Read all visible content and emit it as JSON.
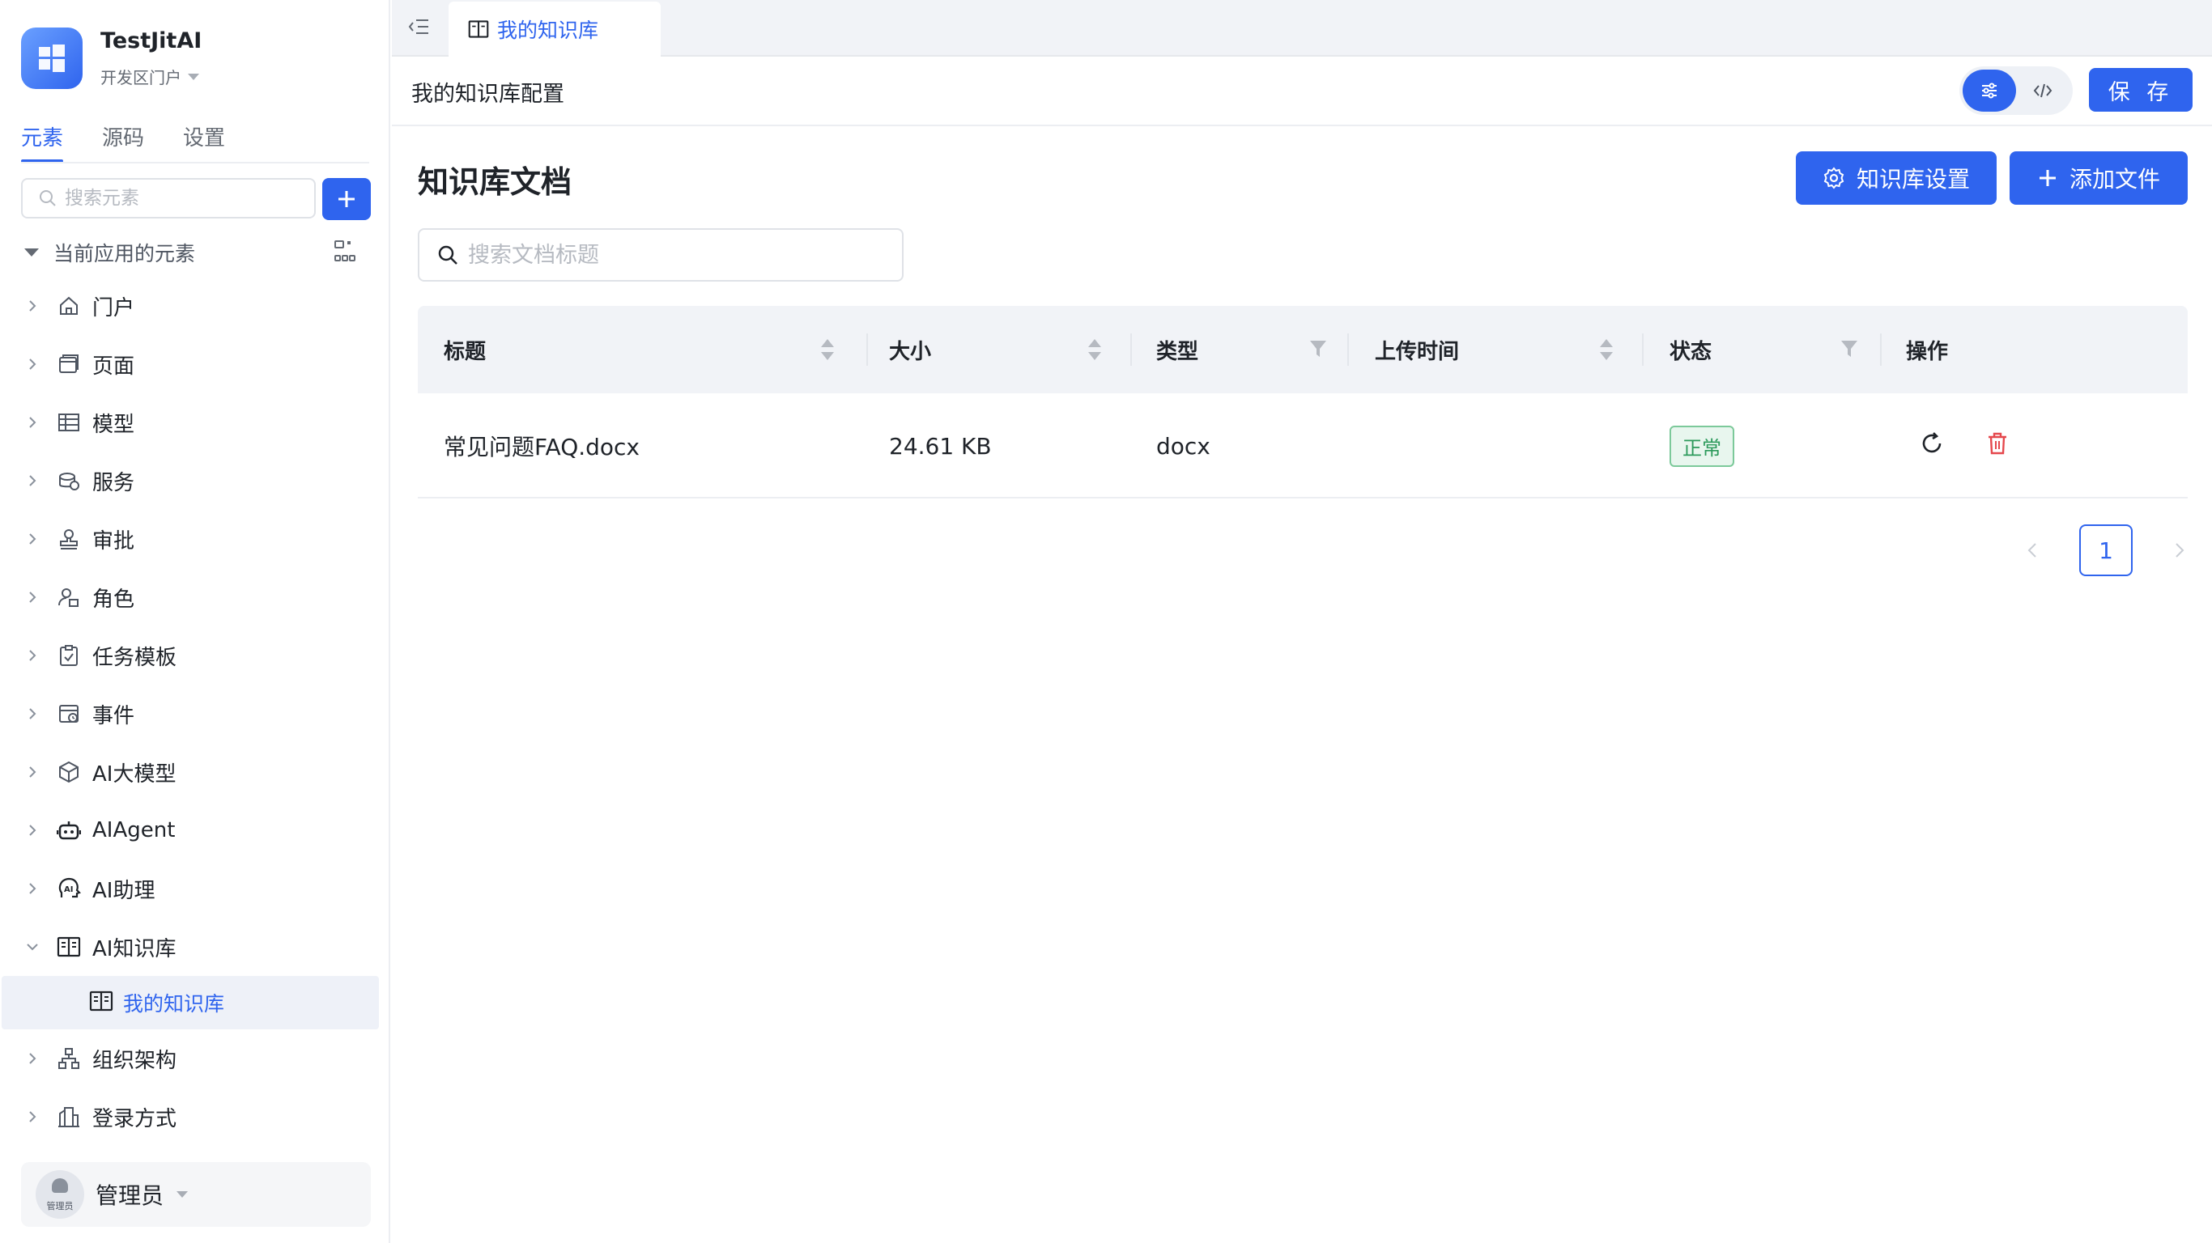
{
  "app": {
    "name": "TestJitAI",
    "portal": "开发区门户"
  },
  "sidebar": {
    "tabs": [
      {
        "label": "元素",
        "active": true
      },
      {
        "label": "源码",
        "active": false
      },
      {
        "label": "设置",
        "active": false
      }
    ],
    "search_placeholder": "搜索元素",
    "root_label": "当前应用的元素",
    "items": [
      {
        "label": "门户",
        "icon": "home-icon"
      },
      {
        "label": "页面",
        "icon": "page-icon"
      },
      {
        "label": "模型",
        "icon": "table-icon"
      },
      {
        "label": "服务",
        "icon": "service-icon"
      },
      {
        "label": "审批",
        "icon": "stamp-icon"
      },
      {
        "label": "角色",
        "icon": "role-icon"
      },
      {
        "label": "任务模板",
        "icon": "clipboard-check-icon"
      },
      {
        "label": "事件",
        "icon": "event-icon"
      },
      {
        "label": "AI大模型",
        "icon": "cube-icon"
      },
      {
        "label": "AIAgent",
        "icon": "robot-icon"
      },
      {
        "label": "AI助理",
        "icon": "ai-head-icon"
      },
      {
        "label": "AI知识库",
        "icon": "book-icon",
        "expanded": true
      },
      {
        "label": "组织架构",
        "icon": "org-chart-icon"
      },
      {
        "label": "登录方式",
        "icon": "building-icon"
      }
    ],
    "selected_child": "我的知识库",
    "user": {
      "name": "管理员",
      "avatar_label": "管理员"
    }
  },
  "topbar": {
    "active_tab": "我的知识库"
  },
  "config": {
    "title": "我的知识库配置",
    "save_label": "保 存"
  },
  "main": {
    "title": "知识库文档",
    "settings_button": "知识库设置",
    "add_button": "添加文件",
    "search_placeholder": "搜索文档标题",
    "columns": [
      "标题",
      "大小",
      "类型",
      "上传时间",
      "状态",
      "操作"
    ],
    "rows": [
      {
        "title": "常见问题FAQ.docx",
        "size": "24.61 KB",
        "type": "docx",
        "upload_time": "",
        "status": "正常"
      }
    ],
    "pagination": {
      "current": "1"
    }
  },
  "colors": {
    "accent": "#2f64ee",
    "success": "#2c9a5b",
    "danger": "#e5484d"
  }
}
